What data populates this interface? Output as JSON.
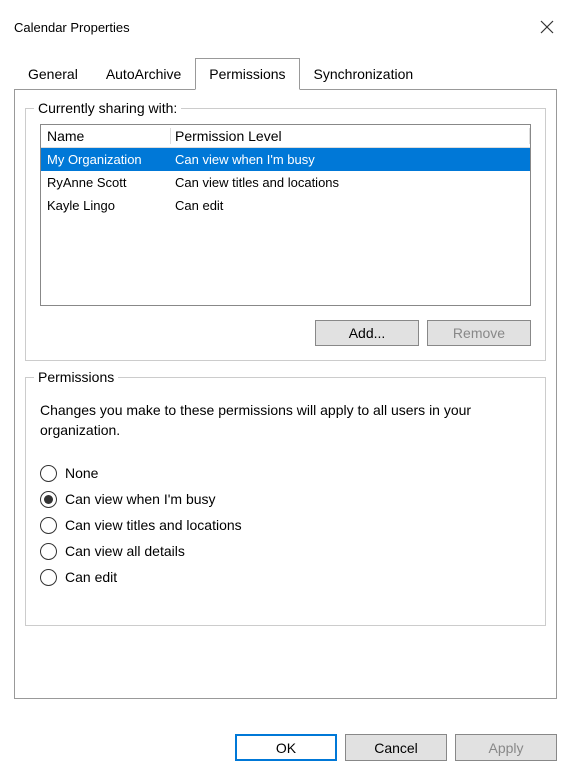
{
  "title": "Calendar Properties",
  "tabs": {
    "general": "General",
    "autoarchive": "AutoArchive",
    "permissions": "Permissions",
    "synchronization": "Synchronization"
  },
  "sharing": {
    "group_label": "Currently sharing with:",
    "headers": {
      "name": "Name",
      "perm": "Permission Level"
    },
    "rows": [
      {
        "name": "My Organization",
        "perm": "Can view when I'm busy",
        "selected": true
      },
      {
        "name": "RyAnne Scott",
        "perm": "Can view titles and locations",
        "selected": false
      },
      {
        "name": "Kayle Lingo",
        "perm": "Can edit",
        "selected": false
      }
    ]
  },
  "buttons": {
    "add": "Add...",
    "remove": "Remove",
    "ok": "OK",
    "cancel": "Cancel",
    "apply": "Apply"
  },
  "permissions": {
    "group_label": "Permissions",
    "desc": "Changes you make to these permissions will apply to all users in your organization.",
    "options": {
      "none": "None",
      "busy": "Can view when I'm busy",
      "titles": "Can view titles and locations",
      "details": "Can view all details",
      "edit": "Can edit"
    },
    "selected": "busy"
  }
}
